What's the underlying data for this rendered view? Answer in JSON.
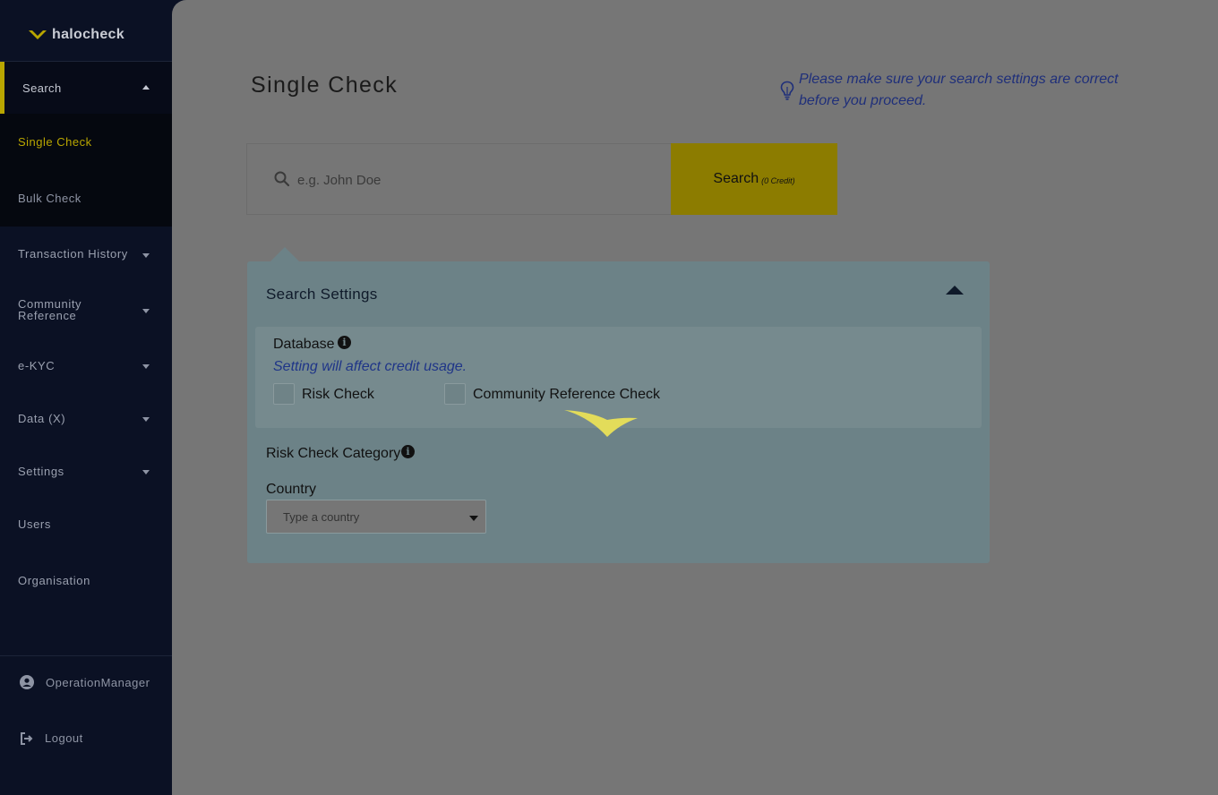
{
  "brand": {
    "name": "halocheck",
    "accent": "#b9a600"
  },
  "sidebar": {
    "search": {
      "label": "Search",
      "expanded": true
    },
    "sub_items": [
      {
        "label": "Single Check",
        "active": true
      },
      {
        "label": "Bulk Check",
        "active": false
      }
    ],
    "items": [
      {
        "label": "Transaction History",
        "dropdown": true
      },
      {
        "label": "Community\nReference",
        "dropdown": true
      },
      {
        "label": "e-KYC",
        "dropdown": true
      },
      {
        "label": "Data (X)",
        "dropdown": true
      },
      {
        "label": "Settings",
        "dropdown": true
      },
      {
        "label": "Users",
        "dropdown": false
      },
      {
        "label": "Organisation",
        "dropdown": false
      }
    ],
    "user": {
      "name": "OperationManager",
      "icon": "user-circle-icon"
    },
    "logout": {
      "label": "Logout",
      "icon": "logout-icon"
    }
  },
  "main": {
    "title": "Single Check",
    "tip": "Please make sure your search settings are correct before you proceed.",
    "search": {
      "placeholder": "e.g. John Doe",
      "button_label": "Search",
      "button_credit": "(0 Credit)"
    },
    "settings": {
      "title": "Search Settings",
      "database": {
        "label": "Database",
        "note": "Setting will affect credit usage.",
        "options": [
          {
            "label": "Risk Check",
            "checked": false
          },
          {
            "label": "Community Reference Check",
            "checked": false
          }
        ]
      },
      "risk_category_label": "Risk Check Category",
      "country": {
        "label": "Country",
        "placeholder": "Type a country"
      }
    }
  }
}
